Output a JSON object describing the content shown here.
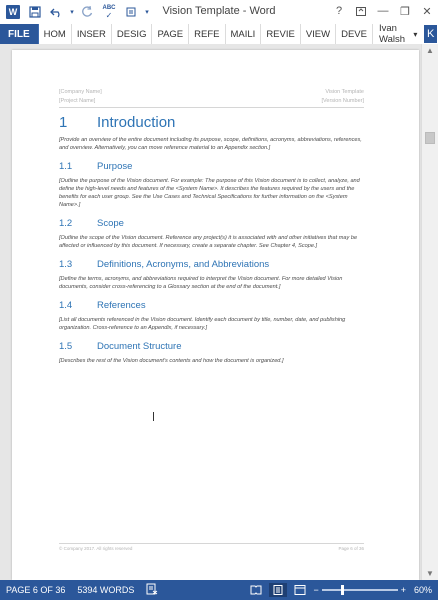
{
  "window": {
    "title": "Vision Template - Word",
    "help": "?",
    "minimize": "—",
    "restore": "❐",
    "close": "✕"
  },
  "qat": {
    "app_icon": "W",
    "save_icon": "save-icon",
    "undo_icon": "undo-icon",
    "redo_icon": "redo-icon",
    "spelling_icon": "spelling-icon",
    "more_icon": "more-icon"
  },
  "ribbon": {
    "file": "FILE",
    "tabs": [
      "HOM",
      "INSER",
      "DESIG",
      "PAGE",
      "REFE",
      "MAILI",
      "REVIE",
      "VIEW",
      "DEVE"
    ],
    "user_name": "Ivan Walsh",
    "user_caret": "▾",
    "avatar_letter": "K",
    "accent_color": "#2b579a"
  },
  "document": {
    "header_left": [
      "[Company Name]",
      "[Project Name]"
    ],
    "header_right": [
      "Vision Template",
      "[Version Number]"
    ],
    "heading1": {
      "number": "1",
      "text": "Introduction"
    },
    "intro": "[Provide an overview of the entire document including its purpose, scope, definitions, acronyms, abbreviations, references, and overview. Alternatively, you can move reference material to an Appendix section.]",
    "sections": [
      {
        "number": "1.1",
        "title": "Purpose",
        "text": "[Outline the purpose of the Vision document. For example: The purpose of this Vision document is to collect, analyze, and define the high-level needs and features of the <System Name>. It describes the features required by the users and the benefits for each user group. See the Use Cases and Technical Specifications for further information on the <System Name>.]"
      },
      {
        "number": "1.2",
        "title": "Scope",
        "text": "[Outline the scope of the Vision document. Reference any project(s) it is associated with and other initiatives that may be affected or influenced by this document. If necessary, create a separate chapter. See Chapter 4, Scope.]"
      },
      {
        "number": "1.3",
        "title": "Definitions, Acronyms, and Abbreviations",
        "text": "[Define the terms, acronyms, and abbreviations required to interpret the Vision document. For more detailed Vision documents, consider cross-referencing to a Glossary section at the end of the document.]"
      },
      {
        "number": "1.4",
        "title": "References",
        "text": "[List all documents referenced in the Vision document. Identify each document by title, number, date, and publishing organization. Cross-reference to an Appendix, if necessary.]"
      },
      {
        "number": "1.5",
        "title": "Document Structure",
        "text": "[Describes the rest of the Vision document's contents and how the document is organized.]"
      }
    ],
    "footer_left": "© Company 2017. All rights reserved",
    "footer_right": "Page 6 of 36"
  },
  "status": {
    "page": "PAGE 6 OF 36",
    "words": "5394 WORDS",
    "proofing_icon": "proofing-icon",
    "read_mode_icon": "read-mode-icon",
    "print_layout_icon": "print-layout-icon",
    "web_layout_icon": "web-layout-icon",
    "zoom_out": "−",
    "zoom_in": "+",
    "zoom": "60%",
    "zoom_level": 60
  }
}
